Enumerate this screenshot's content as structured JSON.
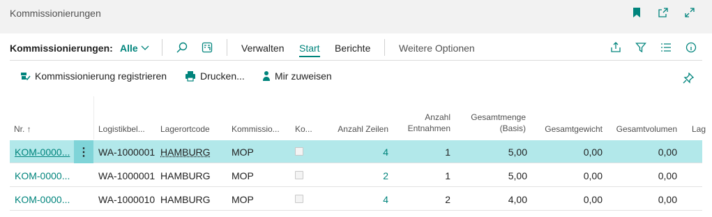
{
  "window": {
    "title": "Kommissionierungen"
  },
  "actionbar": {
    "caption": "Kommissionierungen:",
    "filter": "Alle",
    "tabs": [
      "Verwalten",
      "Start",
      "Berichte"
    ],
    "active_tab": "Start",
    "more": "Weitere Optionen"
  },
  "promoted": {
    "register": "Kommissionierung registrieren",
    "print": "Drucken...",
    "assign": "Mir zuweisen"
  },
  "table": {
    "headers": {
      "nr": "Nr. ↑",
      "beleg": "Logistikbel...",
      "lager": "Lagerortcode",
      "komm": "Kommissio...",
      "ko": "Ko...",
      "zeilen": "Anzahl Zeilen",
      "entnahmen_1": "Anzahl",
      "entnahmen_2": "Entnahmen",
      "menge_1": "Gesamtmenge",
      "menge_2": "(Basis)",
      "gewicht": "Gesamtgewicht",
      "volumen": "Gesamtvolumen",
      "more": "Lag"
    },
    "rows": [
      {
        "nr": "KOM-0000...",
        "beleg": "WA-1000001",
        "lager": "HAMBURG",
        "komm": "MOP",
        "zeilen": "4",
        "entnahmen": "1",
        "menge": "5,00",
        "gewicht": "0,00",
        "volumen": "0,00"
      },
      {
        "nr": "KOM-0000...",
        "beleg": "WA-1000001",
        "lager": "HAMBURG",
        "komm": "MOP",
        "zeilen": "2",
        "entnahmen": "1",
        "menge": "5,00",
        "gewicht": "0,00",
        "volumen": "0,00"
      },
      {
        "nr": "KOM-0000...",
        "beleg": "WA-1000010",
        "lager": "HAMBURG",
        "komm": "MOP",
        "zeilen": "4",
        "entnahmen": "2",
        "menge": "4,00",
        "gewicht": "0,00",
        "volumen": "0,00"
      }
    ]
  },
  "colors": {
    "accent": "#00847c",
    "selected_row": "#b2e8ea",
    "titlebar": "#f2f2f2"
  },
  "icons": {
    "title": [
      "bookmark-icon",
      "open-new-window-icon",
      "expand-icon"
    ],
    "actionbar": [
      "search-icon",
      "edit-list-icon",
      "share-icon",
      "filter-icon",
      "list-view-icon",
      "info-icon"
    ],
    "promoted": [
      "register-icon",
      "print-icon",
      "person-icon",
      "pin-icon"
    ]
  }
}
